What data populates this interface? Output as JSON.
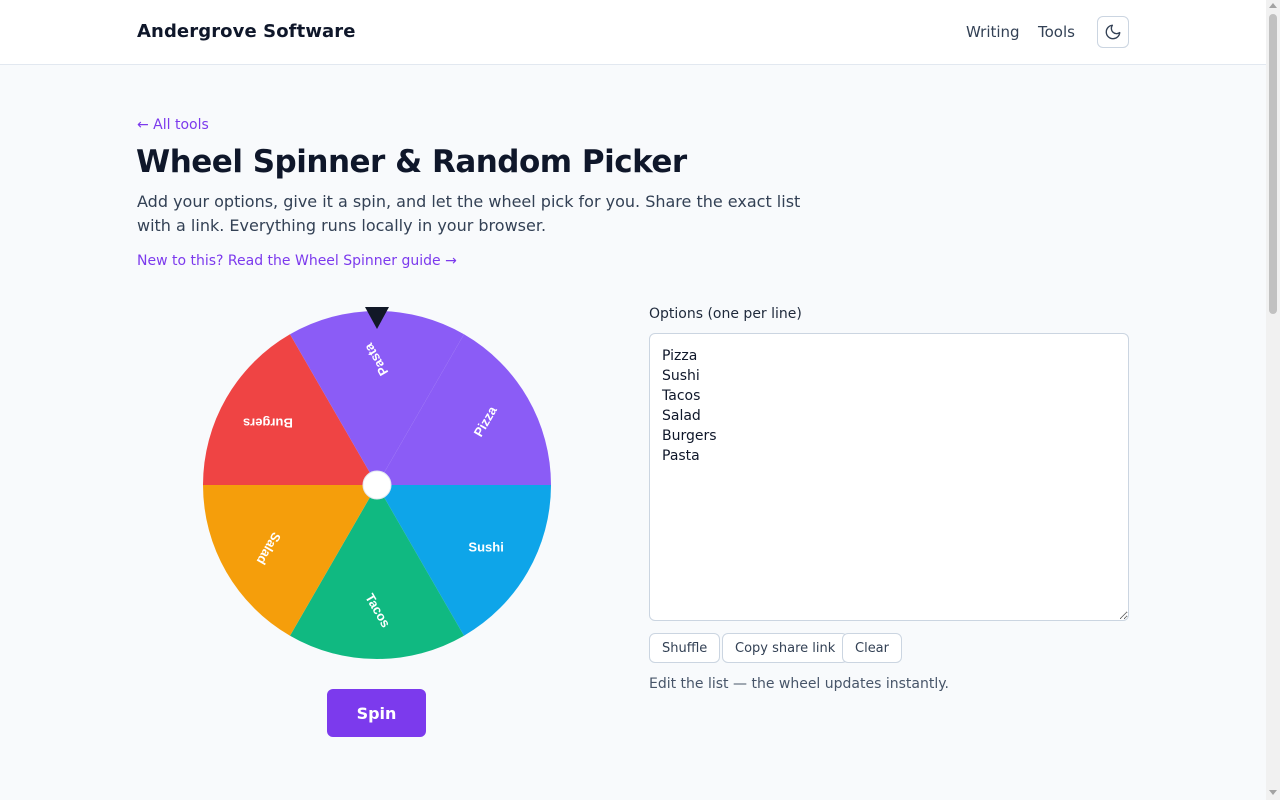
{
  "header": {
    "brand": "Andergrove Software",
    "nav": [
      "Writing",
      "Tools"
    ],
    "theme_toggle_icon": "moon-icon"
  },
  "page": {
    "back_link": "← All tools",
    "title": "Wheel Spinner & Random Picker",
    "subtitle": "Add your options, give it a spin, and let the wheel pick for you. Share the exact list with a link. Everything runs locally in your browser.",
    "guide_link": "New to this? Read the Wheel Spinner guide →"
  },
  "wheel": {
    "slices": [
      {
        "label": "Pizza",
        "color": "#8b5cf6"
      },
      {
        "label": "Sushi",
        "color": "#0ea5e9"
      },
      {
        "label": "Tacos",
        "color": "#10b981"
      },
      {
        "label": "Salad",
        "color": "#f59e0b"
      },
      {
        "label": "Burgers",
        "color": "#ef4444"
      },
      {
        "label": "Pasta",
        "color": "#8b5cf6"
      }
    ],
    "pointer_icon": "pointer-triangle-icon",
    "spin_label": "Spin"
  },
  "options": {
    "label": "Options (one per line)",
    "value": "Pizza\nSushi\nTacos\nSalad\nBurgers\nPasta",
    "buttons": {
      "shuffle": "Shuffle",
      "copy": "Copy share link",
      "clear": "Clear"
    },
    "hint": "Edit the list — the wheel updates instantly."
  },
  "colors": {
    "accent": "#7c3aed",
    "text": "#0f172a",
    "muted": "#475569",
    "background": "#f8fafc"
  }
}
